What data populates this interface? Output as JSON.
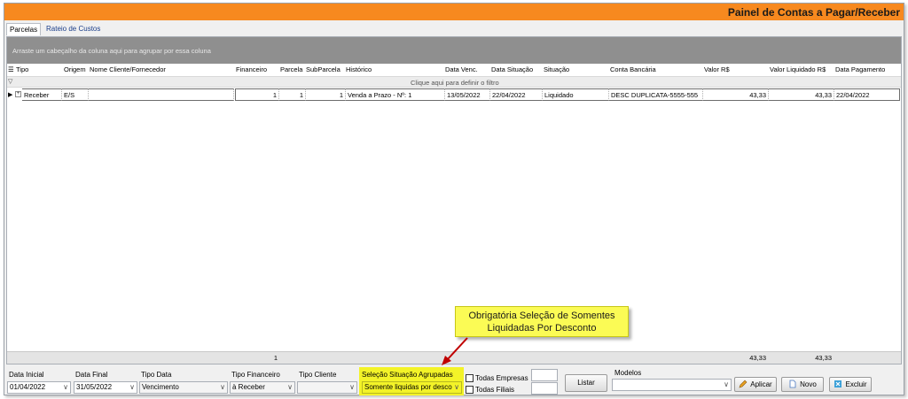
{
  "window": {
    "title": "Painel de Contas a Pagar/Receber"
  },
  "tabs": [
    {
      "label": "Parcelas"
    },
    {
      "label": "Rateio de Custos"
    }
  ],
  "grid": {
    "group_hint": "Arraste um cabeçalho da coluna aqui para agrupar por essa coluna",
    "filter_hint": "Clique aqui para definir o filtro",
    "columns": [
      "Tipo",
      "Origem",
      "Nome Cliente/Fornecedor",
      "Financeiro",
      "Parcela",
      "SubParcela",
      "Histórico",
      "Data Venc.",
      "Data Situação",
      "Situação",
      "Conta Bancária",
      "Valor R$",
      "Valor Liquidado R$",
      "Data Pagamento"
    ],
    "rows": [
      {
        "tipo": "Receber",
        "origem": "E/S",
        "nome": "",
        "financeiro": "1",
        "parcela": "1",
        "subparcela": "1",
        "historico": "Venda a Prazo - Nº: 1",
        "data_venc": "13/05/2022",
        "data_situacao": "22/04/2022",
        "situacao": "Liquidado",
        "conta": "DESC DUPLICATA-5555-555",
        "valor": "43,33",
        "valor_liquidado": "43,33",
        "data_pagamento": "22/04/2022"
      }
    ],
    "footer": {
      "count": "1",
      "valor_total": "43,33",
      "liquidado_total": "43,33"
    }
  },
  "callout": {
    "line1": "Obrigatória Seleção de Somentes",
    "line2": "Liquidadas Por Desconto"
  },
  "filters": {
    "data_inicial": {
      "label": "Data Inicial",
      "value": "01/04/2022"
    },
    "data_final": {
      "label": "Data Final",
      "value": "31/05/2022"
    },
    "tipo_data": {
      "label": "Tipo Data",
      "value": "Vencimento"
    },
    "tipo_financeiro": {
      "label": "Tipo Financeiro",
      "value": "à Receber"
    },
    "tipo_cliente": {
      "label": "Tipo Cliente",
      "value": ""
    },
    "selecao_situacao": {
      "label": "Seleção Situação Agrupadas",
      "value": "Somente liquidas por desco"
    },
    "todas_empresas": "Todas Empresas",
    "todas_filiais": "Todas Filiais",
    "modelos": {
      "label": "Modelos",
      "value": ""
    }
  },
  "buttons": {
    "listar": "Listar",
    "aplicar": "Aplicar",
    "novo": "Novo",
    "excluir": "Excluir"
  },
  "colors": {
    "titlebar": "#f7891f",
    "highlight": "#f3f328",
    "callout": "#fbfb55",
    "arrow": "#c00000"
  }
}
